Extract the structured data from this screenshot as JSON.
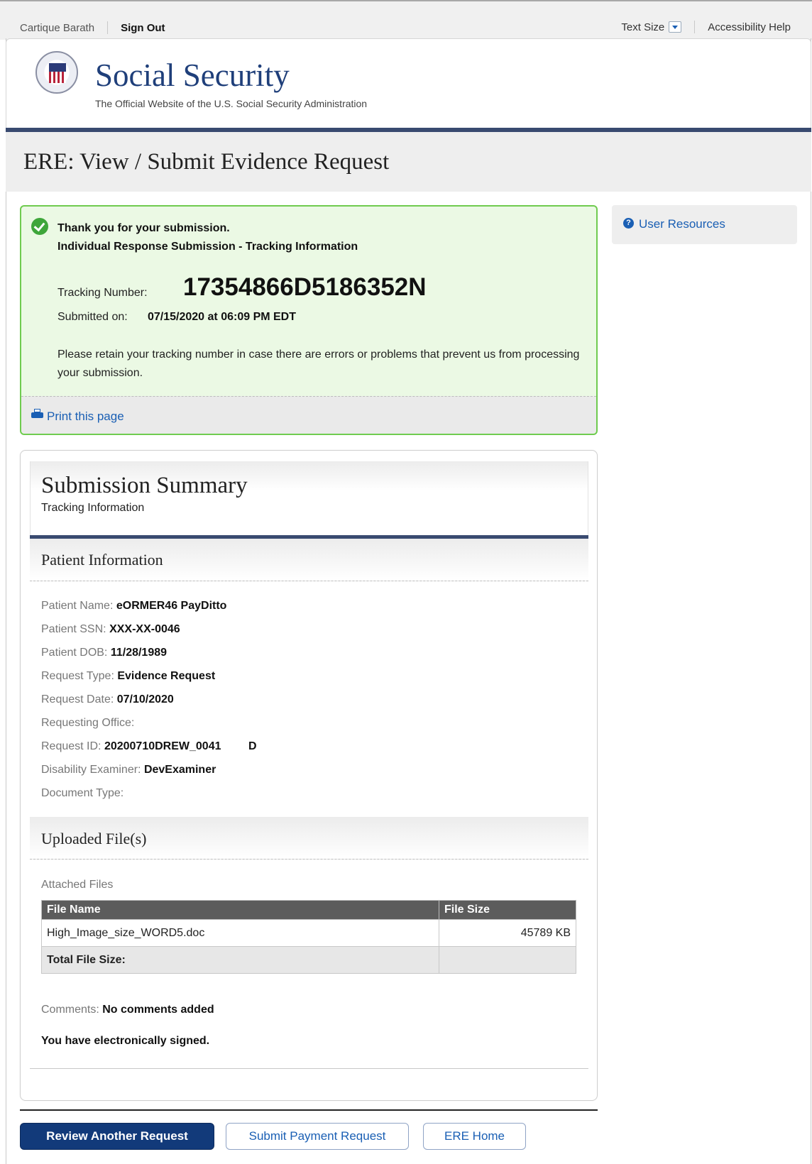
{
  "topbar": {
    "user_name": "Cartique Barath",
    "sign_out": "Sign Out",
    "text_size": "Text Size",
    "accessibility_help": "Accessibility Help"
  },
  "header": {
    "title": "Social Security",
    "subtitle": "The Official Website of the U.S. Social Security Administration"
  },
  "page": {
    "title": "ERE: View / Submit Evidence Request"
  },
  "success": {
    "line1": "Thank you for your submission.",
    "line2": "Individual Response Submission - Tracking Information",
    "tracking_label": "Tracking Number:",
    "tracking_number": "17354866D5186352N",
    "submitted_label": "Submitted on:",
    "submitted_value": "07/15/2020 at 06:09 PM EDT",
    "retain_text": "Please retain your tracking number in case there are errors or problems that prevent us from processing your submission.",
    "print_link": "Print this page"
  },
  "sidebar": {
    "user_resources": "User Resources"
  },
  "summary": {
    "title": "Submission Summary",
    "subtitle": "Tracking Information",
    "patient_section": "Patient Information",
    "fields": [
      {
        "label": "Patient Name:",
        "value": "eORMER46 PayDitto"
      },
      {
        "label": "Patient SSN:",
        "value": "XXX-XX-0046"
      },
      {
        "label": "Patient DOB:",
        "value": "11/28/1989"
      },
      {
        "label": "Request Type:",
        "value": "Evidence Request"
      },
      {
        "label": "Request Date:",
        "value": "07/10/2020"
      },
      {
        "label": "Requesting Office:",
        "value": ""
      },
      {
        "label": "Request ID:",
        "value": "20200710DREW_0041",
        "extra": "D"
      },
      {
        "label": "Disability Examiner:",
        "value": "DevExaminer"
      },
      {
        "label": "Document Type:",
        "value": ""
      }
    ],
    "uploaded_section": "Uploaded File(s)",
    "attached_label": "Attached Files",
    "table": {
      "headers": [
        "File Name",
        "File Size"
      ],
      "rows": [
        {
          "name": "High_Image_size_WORD5.doc",
          "size": "45789 KB"
        }
      ],
      "total_label": "Total File Size:",
      "total_value": ""
    },
    "comments_label": "Comments:",
    "comments_value": "No comments added",
    "signed_text": "You have electronically signed."
  },
  "buttons": {
    "review_another": "Review Another Request",
    "submit_payment": "Submit Payment Request",
    "ere_home": "ERE Home"
  },
  "colors": {
    "brand_blue": "#1f3f7a",
    "link_blue": "#1a5fb4",
    "success_green": "#6fcb4f",
    "primary_button": "#123a7a"
  }
}
